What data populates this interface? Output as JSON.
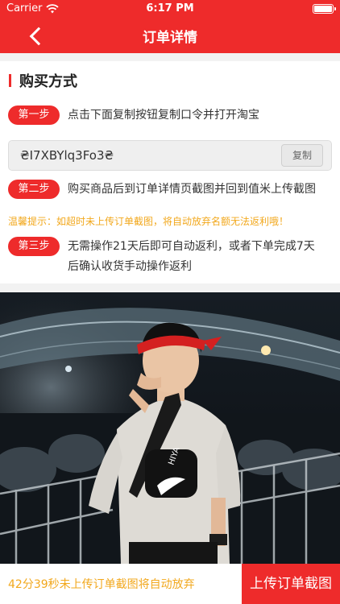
{
  "status_bar": {
    "carrier": "Carrier",
    "time": "6:17 PM"
  },
  "nav": {
    "title": "订单详情"
  },
  "section": {
    "title": "购买方式"
  },
  "steps": [
    {
      "label": "第一步",
      "text": "点击下面复制按钮复制口令并打开淘宝"
    },
    {
      "label": "第二步",
      "text": "购买商品后到订单详情页截图并回到值米上传截图"
    },
    {
      "label": "第三步",
      "line1": "无需操作21天后即可自动返利，或者下单完成7天",
      "line2": "后确认收货手动操作返利"
    }
  ],
  "code": {
    "value": "₴I7XBYlq3Fo3₴",
    "copy_label": "复制"
  },
  "tip": "温馨提示：如超时未上传订单截图，将自动放弃名额无法返利哦！",
  "product": {
    "bag_logo": "HIYA"
  },
  "bottom": {
    "countdown": "42分39秒未上传订单截图将自动放弃",
    "upload_label": "上传订单截图"
  },
  "colors": {
    "brand_red": "#ee2b2b",
    "tip_orange": "#f2a81d"
  }
}
